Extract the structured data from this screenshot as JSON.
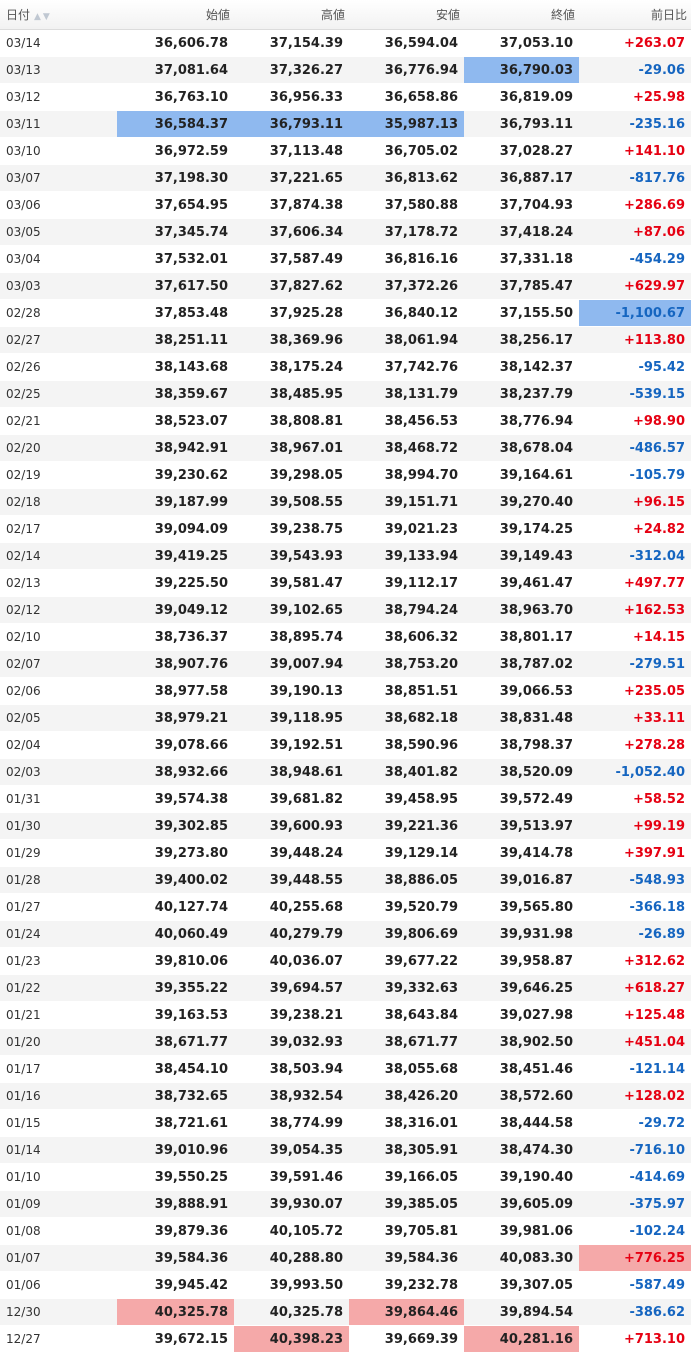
{
  "header": {
    "date": "日付",
    "open": "始値",
    "high": "高値",
    "low": "安値",
    "close": "終値",
    "change": "前日比"
  },
  "colors": {
    "up": "#e60012",
    "down": "#1565c0",
    "highlight_min": "#8fb9ef",
    "highlight_max": "#f5a9a9"
  },
  "rows": [
    {
      "date": "03/14",
      "open": "36,606.78",
      "high": "37,154.39",
      "low": "36,594.04",
      "close": "37,053.10",
      "change": "+263.07"
    },
    {
      "date": "03/13",
      "open": "37,081.64",
      "high": "37,326.27",
      "low": "36,776.94",
      "close": "36,790.03",
      "change": "-29.06",
      "hl": {
        "close": "min"
      }
    },
    {
      "date": "03/12",
      "open": "36,763.10",
      "high": "36,956.33",
      "low": "36,658.86",
      "close": "36,819.09",
      "change": "+25.98"
    },
    {
      "date": "03/11",
      "open": "36,584.37",
      "high": "36,793.11",
      "low": "35,987.13",
      "close": "36,793.11",
      "change": "-235.16",
      "hl": {
        "open": "min",
        "high": "min",
        "low": "min"
      }
    },
    {
      "date": "03/10",
      "open": "36,972.59",
      "high": "37,113.48",
      "low": "36,705.02",
      "close": "37,028.27",
      "change": "+141.10"
    },
    {
      "date": "03/07",
      "open": "37,198.30",
      "high": "37,221.65",
      "low": "36,813.62",
      "close": "36,887.17",
      "change": "-817.76"
    },
    {
      "date": "03/06",
      "open": "37,654.95",
      "high": "37,874.38",
      "low": "37,580.88",
      "close": "37,704.93",
      "change": "+286.69"
    },
    {
      "date": "03/05",
      "open": "37,345.74",
      "high": "37,606.34",
      "low": "37,178.72",
      "close": "37,418.24",
      "change": "+87.06"
    },
    {
      "date": "03/04",
      "open": "37,532.01",
      "high": "37,587.49",
      "low": "36,816.16",
      "close": "37,331.18",
      "change": "-454.29"
    },
    {
      "date": "03/03",
      "open": "37,617.50",
      "high": "37,827.62",
      "low": "37,372.26",
      "close": "37,785.47",
      "change": "+629.97"
    },
    {
      "date": "02/28",
      "open": "37,853.48",
      "high": "37,925.28",
      "low": "36,840.12",
      "close": "37,155.50",
      "change": "-1,100.67",
      "hl": {
        "change": "min"
      }
    },
    {
      "date": "02/27",
      "open": "38,251.11",
      "high": "38,369.96",
      "low": "38,061.94",
      "close": "38,256.17",
      "change": "+113.80"
    },
    {
      "date": "02/26",
      "open": "38,143.68",
      "high": "38,175.24",
      "low": "37,742.76",
      "close": "38,142.37",
      "change": "-95.42"
    },
    {
      "date": "02/25",
      "open": "38,359.67",
      "high": "38,485.95",
      "low": "38,131.79",
      "close": "38,237.79",
      "change": "-539.15"
    },
    {
      "date": "02/21",
      "open": "38,523.07",
      "high": "38,808.81",
      "low": "38,456.53",
      "close": "38,776.94",
      "change": "+98.90"
    },
    {
      "date": "02/20",
      "open": "38,942.91",
      "high": "38,967.01",
      "low": "38,468.72",
      "close": "38,678.04",
      "change": "-486.57"
    },
    {
      "date": "02/19",
      "open": "39,230.62",
      "high": "39,298.05",
      "low": "38,994.70",
      "close": "39,164.61",
      "change": "-105.79"
    },
    {
      "date": "02/18",
      "open": "39,187.99",
      "high": "39,508.55",
      "low": "39,151.71",
      "close": "39,270.40",
      "change": "+96.15"
    },
    {
      "date": "02/17",
      "open": "39,094.09",
      "high": "39,238.75",
      "low": "39,021.23",
      "close": "39,174.25",
      "change": "+24.82"
    },
    {
      "date": "02/14",
      "open": "39,419.25",
      "high": "39,543.93",
      "low": "39,133.94",
      "close": "39,149.43",
      "change": "-312.04"
    },
    {
      "date": "02/13",
      "open": "39,225.50",
      "high": "39,581.47",
      "low": "39,112.17",
      "close": "39,461.47",
      "change": "+497.77"
    },
    {
      "date": "02/12",
      "open": "39,049.12",
      "high": "39,102.65",
      "low": "38,794.24",
      "close": "38,963.70",
      "change": "+162.53"
    },
    {
      "date": "02/10",
      "open": "38,736.37",
      "high": "38,895.74",
      "low": "38,606.32",
      "close": "38,801.17",
      "change": "+14.15"
    },
    {
      "date": "02/07",
      "open": "38,907.76",
      "high": "39,007.94",
      "low": "38,753.20",
      "close": "38,787.02",
      "change": "-279.51"
    },
    {
      "date": "02/06",
      "open": "38,977.58",
      "high": "39,190.13",
      "low": "38,851.51",
      "close": "39,066.53",
      "change": "+235.05"
    },
    {
      "date": "02/05",
      "open": "38,979.21",
      "high": "39,118.95",
      "low": "38,682.18",
      "close": "38,831.48",
      "change": "+33.11"
    },
    {
      "date": "02/04",
      "open": "39,078.66",
      "high": "39,192.51",
      "low": "38,590.96",
      "close": "38,798.37",
      "change": "+278.28"
    },
    {
      "date": "02/03",
      "open": "38,932.66",
      "high": "38,948.61",
      "low": "38,401.82",
      "close": "38,520.09",
      "change": "-1,052.40"
    },
    {
      "date": "01/31",
      "open": "39,574.38",
      "high": "39,681.82",
      "low": "39,458.95",
      "close": "39,572.49",
      "change": "+58.52"
    },
    {
      "date": "01/30",
      "open": "39,302.85",
      "high": "39,600.93",
      "low": "39,221.36",
      "close": "39,513.97",
      "change": "+99.19"
    },
    {
      "date": "01/29",
      "open": "39,273.80",
      "high": "39,448.24",
      "low": "39,129.14",
      "close": "39,414.78",
      "change": "+397.91"
    },
    {
      "date": "01/28",
      "open": "39,400.02",
      "high": "39,448.55",
      "low": "38,886.05",
      "close": "39,016.87",
      "change": "-548.93"
    },
    {
      "date": "01/27",
      "open": "40,127.74",
      "high": "40,255.68",
      "low": "39,520.79",
      "close": "39,565.80",
      "change": "-366.18"
    },
    {
      "date": "01/24",
      "open": "40,060.49",
      "high": "40,279.79",
      "low": "39,806.69",
      "close": "39,931.98",
      "change": "-26.89"
    },
    {
      "date": "01/23",
      "open": "39,810.06",
      "high": "40,036.07",
      "low": "39,677.22",
      "close": "39,958.87",
      "change": "+312.62"
    },
    {
      "date": "01/22",
      "open": "39,355.22",
      "high": "39,694.57",
      "low": "39,332.63",
      "close": "39,646.25",
      "change": "+618.27"
    },
    {
      "date": "01/21",
      "open": "39,163.53",
      "high": "39,238.21",
      "low": "38,643.84",
      "close": "39,027.98",
      "change": "+125.48"
    },
    {
      "date": "01/20",
      "open": "38,671.77",
      "high": "39,032.93",
      "low": "38,671.77",
      "close": "38,902.50",
      "change": "+451.04"
    },
    {
      "date": "01/17",
      "open": "38,454.10",
      "high": "38,503.94",
      "low": "38,055.68",
      "close": "38,451.46",
      "change": "-121.14"
    },
    {
      "date": "01/16",
      "open": "38,732.65",
      "high": "38,932.54",
      "low": "38,426.20",
      "close": "38,572.60",
      "change": "+128.02"
    },
    {
      "date": "01/15",
      "open": "38,721.61",
      "high": "38,774.99",
      "low": "38,316.01",
      "close": "38,444.58",
      "change": "-29.72"
    },
    {
      "date": "01/14",
      "open": "39,010.96",
      "high": "39,054.35",
      "low": "38,305.91",
      "close": "38,474.30",
      "change": "-716.10"
    },
    {
      "date": "01/10",
      "open": "39,550.25",
      "high": "39,591.46",
      "low": "39,166.05",
      "close": "39,190.40",
      "change": "-414.69"
    },
    {
      "date": "01/09",
      "open": "39,888.91",
      "high": "39,930.07",
      "low": "39,385.05",
      "close": "39,605.09",
      "change": "-375.97"
    },
    {
      "date": "01/08",
      "open": "39,879.36",
      "high": "40,105.72",
      "low": "39,705.81",
      "close": "39,981.06",
      "change": "-102.24"
    },
    {
      "date": "01/07",
      "open": "39,584.36",
      "high": "40,288.80",
      "low": "39,584.36",
      "close": "40,083.30",
      "change": "+776.25",
      "hl": {
        "change": "max"
      }
    },
    {
      "date": "01/06",
      "open": "39,945.42",
      "high": "39,993.50",
      "low": "39,232.78",
      "close": "39,307.05",
      "change": "-587.49"
    },
    {
      "date": "12/30",
      "open": "40,325.78",
      "high": "40,325.78",
      "low": "39,864.46",
      "close": "39,894.54",
      "change": "-386.62",
      "hl": {
        "open": "max",
        "low": "max"
      }
    },
    {
      "date": "12/27",
      "open": "39,672.15",
      "high": "40,398.23",
      "low": "39,669.39",
      "close": "40,281.16",
      "change": "+713.10",
      "hl": {
        "high": "max",
        "close": "max"
      }
    }
  ]
}
